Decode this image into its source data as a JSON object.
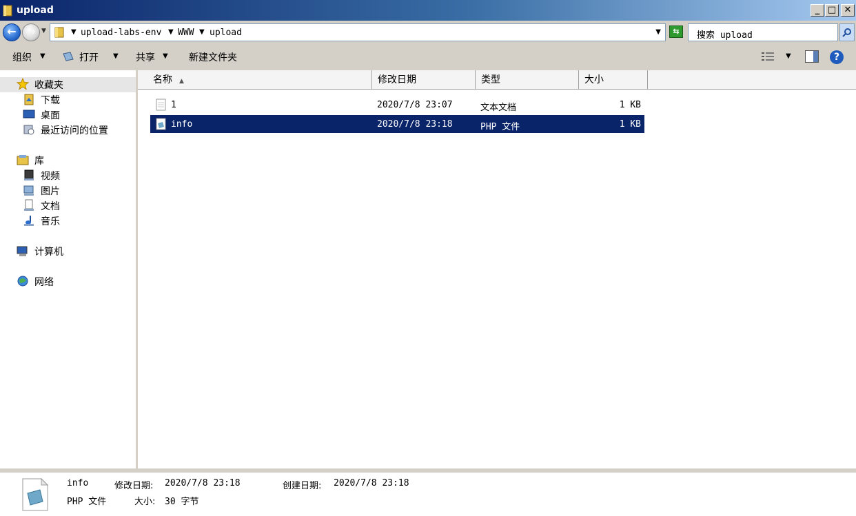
{
  "window": {
    "title": "upload",
    "caption_buttons": {
      "minimize": "_",
      "maximize": "□",
      "close": "✕"
    }
  },
  "address": {
    "back_icon": "back-arrow-icon",
    "forward_icon": "forward-arrow-icon",
    "breadcrumbs": [
      "upload-labs-env",
      "WWW",
      "upload"
    ],
    "search_placeholder": "搜索 upload"
  },
  "toolbar": {
    "organize": "组织",
    "open": "打开",
    "share": "共享",
    "new_folder": "新建文件夹"
  },
  "sidebar": {
    "favorites": {
      "label": "收藏夹",
      "items": [
        "下载",
        "桌面",
        "最近访问的位置"
      ]
    },
    "libraries": {
      "label": "库",
      "items": [
        "视频",
        "图片",
        "文档",
        "音乐"
      ]
    },
    "computer": "计算机",
    "network": "网络"
  },
  "columns": [
    "名称",
    "修改日期",
    "类型",
    "大小"
  ],
  "files": [
    {
      "name": "1",
      "modified": "2020/7/8 23:07",
      "type": "文本文档",
      "size": "1 KB",
      "icon": "text-file-icon",
      "selected": false
    },
    {
      "name": "info",
      "modified": "2020/7/8 23:18",
      "type": "PHP 文件",
      "size": "1 KB",
      "icon": "php-file-icon",
      "selected": true
    }
  ],
  "details": {
    "name": "info",
    "type": "PHP 文件",
    "modified_label": "修改日期:",
    "modified_value": "2020/7/8 23:18",
    "created_label": "创建日期:",
    "created_value": "2020/7/8 23:18",
    "size_label": "大小:",
    "size_value": "30 字节"
  },
  "colors": {
    "selection": "#0a246a",
    "titlebar": "#0a246a",
    "chrome": "#d4d0c8"
  }
}
